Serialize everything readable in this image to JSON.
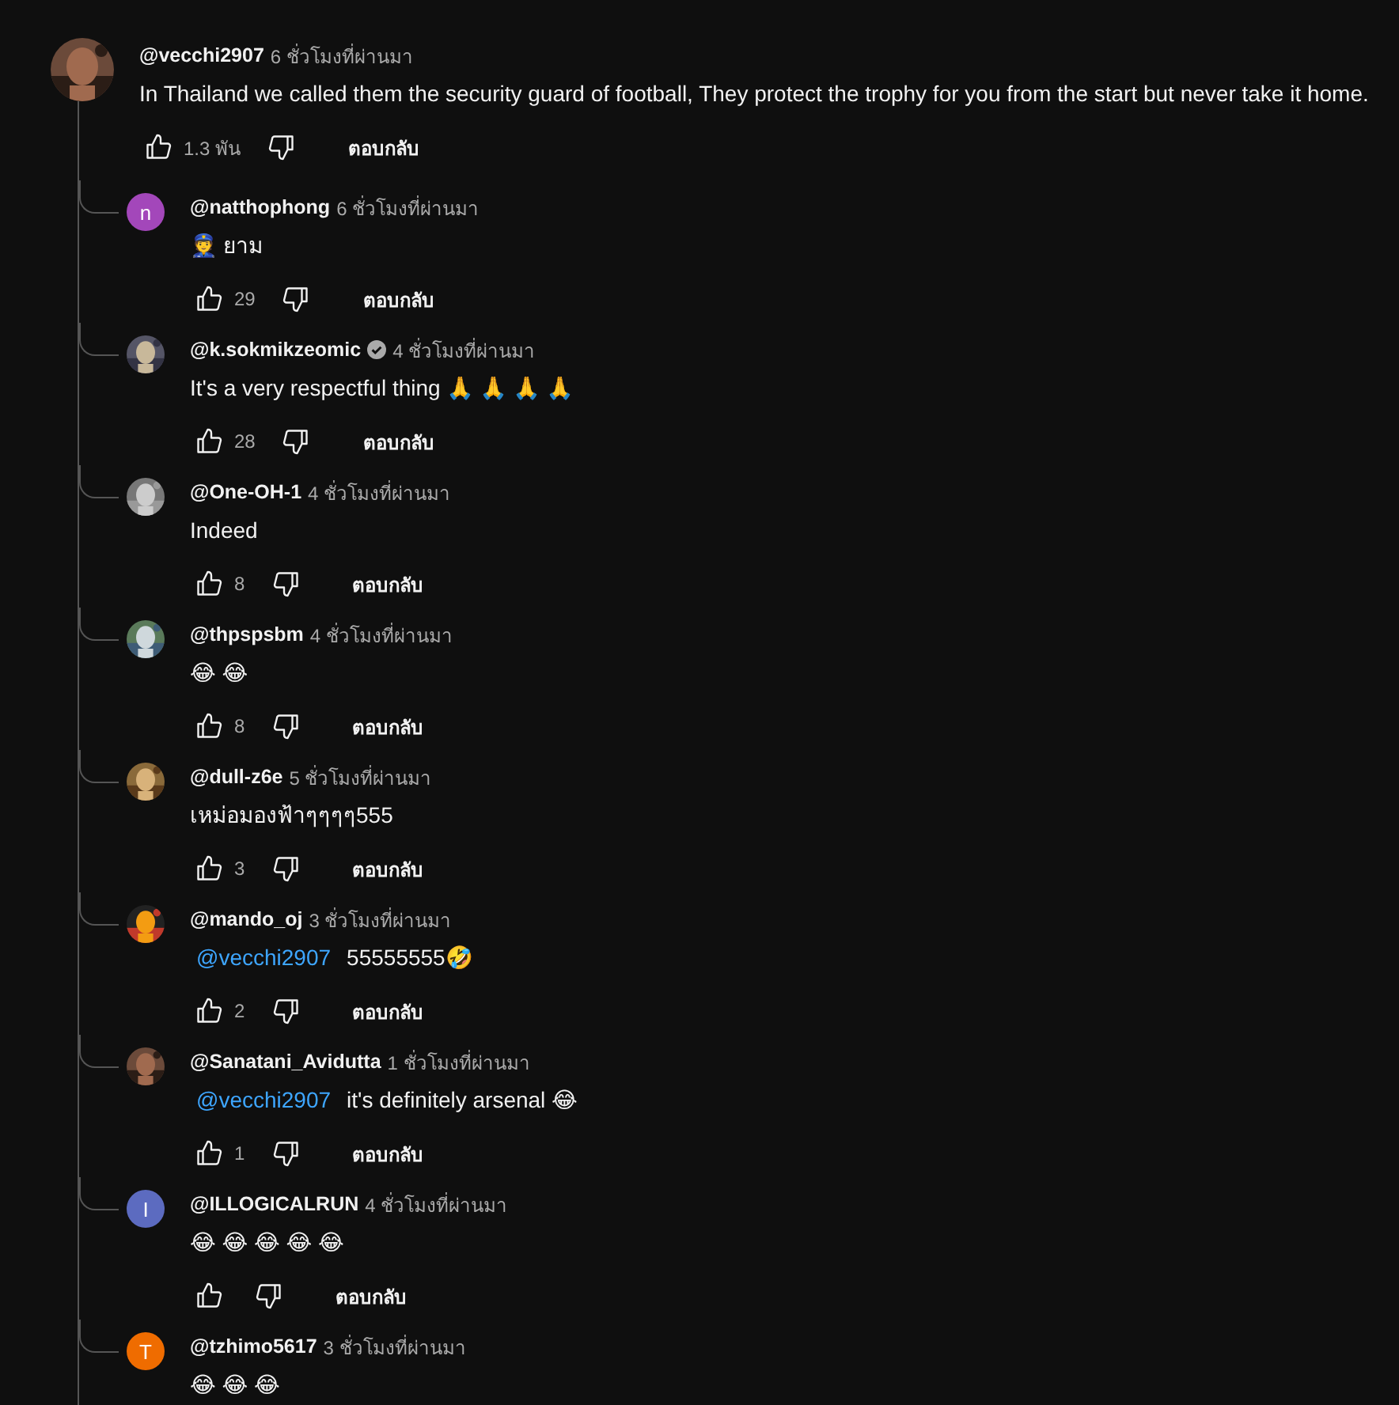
{
  "comment": {
    "author": "@vecchi2907",
    "time": "6 ชั่วโมงที่ผ่านมา",
    "verified": false,
    "text": "In Thailand we called them the security guard of football, They protect the trophy for you from the start but never take it home.",
    "likes": "1.3 พัน",
    "reply_label": "ตอบกลับ"
  },
  "replies": [
    {
      "author": "@natthophong",
      "time": "6 ชั่วโมงที่ผ่านมา",
      "avatar": {
        "kind": "letter",
        "letter": "n",
        "color": "#a347ba"
      },
      "verified": false,
      "text": "👮 ยาม",
      "likes": "29",
      "reply_label": "ตอบกลับ"
    },
    {
      "author": "@k.sokmikzeomic",
      "time": "4 ชั่วโมงที่ผ่านมา",
      "verified": true,
      "text": "It's a very respectful thing 🙏 🙏 🙏 🙏",
      "likes": "28",
      "reply_label": "ตอบกลับ"
    },
    {
      "author": "@One-OH-1",
      "time": "4 ชั่วโมงที่ผ่านมา",
      "verified": false,
      "text": "Indeed",
      "likes": "8",
      "reply_label": "ตอบกลับ"
    },
    {
      "author": "@thpspsbm",
      "time": "4 ชั่วโมงที่ผ่านมา",
      "verified": false,
      "text": "😂 😂",
      "likes": "8",
      "reply_label": "ตอบกลับ"
    },
    {
      "author": "@dull-z6e",
      "time": "5 ชั่วโมงที่ผ่านมา",
      "verified": false,
      "text": "เหม่อมองฟ้าๆๆๆๆ555",
      "likes": "3",
      "reply_label": "ตอบกลับ"
    },
    {
      "author": "@mando_oj",
      "time": "3 ชั่วโมงที่ผ่านมา",
      "verified": false,
      "mention": "@vecchi2907",
      "text": "55555555🤣",
      "likes": "2",
      "reply_label": "ตอบกลับ"
    },
    {
      "author": "@Sanatani_Avidutta",
      "time": "1 ชั่วโมงที่ผ่านมา",
      "verified": false,
      "mention": "@vecchi2907",
      "text": "it's definitely arsenal 😂",
      "likes": "1",
      "reply_label": "ตอบกลับ"
    },
    {
      "author": "@ILLOGICALRUN",
      "time": "4 ชั่วโมงที่ผ่านมา",
      "avatar": {
        "kind": "letter",
        "letter": "I",
        "color": "#5c6bc0"
      },
      "verified": false,
      "text": "😂 😂 😂 😂 😂",
      "reply_label": "ตอบกลับ"
    },
    {
      "author": "@tzhimo5617",
      "time": "3 ชั่วโมงที่ผ่านมา",
      "avatar": {
        "kind": "letter",
        "letter": "T",
        "color": "#ef6c00"
      },
      "verified": false,
      "text": "😂 😂 😂"
    }
  ]
}
